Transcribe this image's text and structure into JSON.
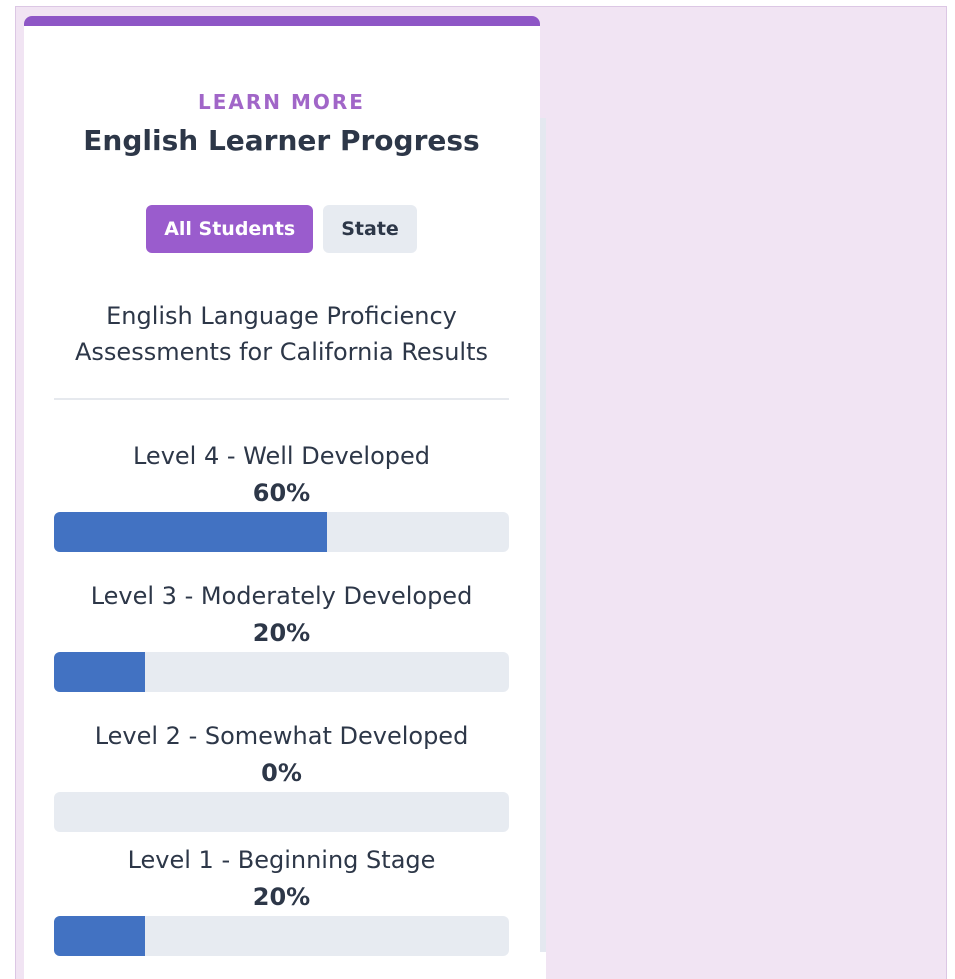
{
  "card": {
    "eyebrow": "LEARN MORE",
    "title": "English Learner Progress",
    "subtitle_line1": "English Language Proficiency",
    "subtitle_line2": "Assessments for California Results"
  },
  "tabs": [
    {
      "label": "All Students",
      "active": true
    },
    {
      "label": "State",
      "active": false
    }
  ],
  "levels": [
    {
      "label": "Level 4 - Well Developed",
      "percent_text": "60%",
      "fraction": 0.6
    },
    {
      "label": "Level 3 - Moderately Developed",
      "percent_text": "20%",
      "fraction": 0.2
    },
    {
      "label": "Level 2 - Somewhat Developed",
      "percent_text": "0%",
      "fraction": 0.0
    },
    {
      "label": "Level 1 - Beginning Stage",
      "percent_text": "20%",
      "fraction": 0.2
    }
  ],
  "colors": {
    "accent": "#9a5ccd",
    "bar_fill": "#4272c2",
    "bar_track": "#e7ebf1",
    "background": "#f1e4f3"
  }
}
